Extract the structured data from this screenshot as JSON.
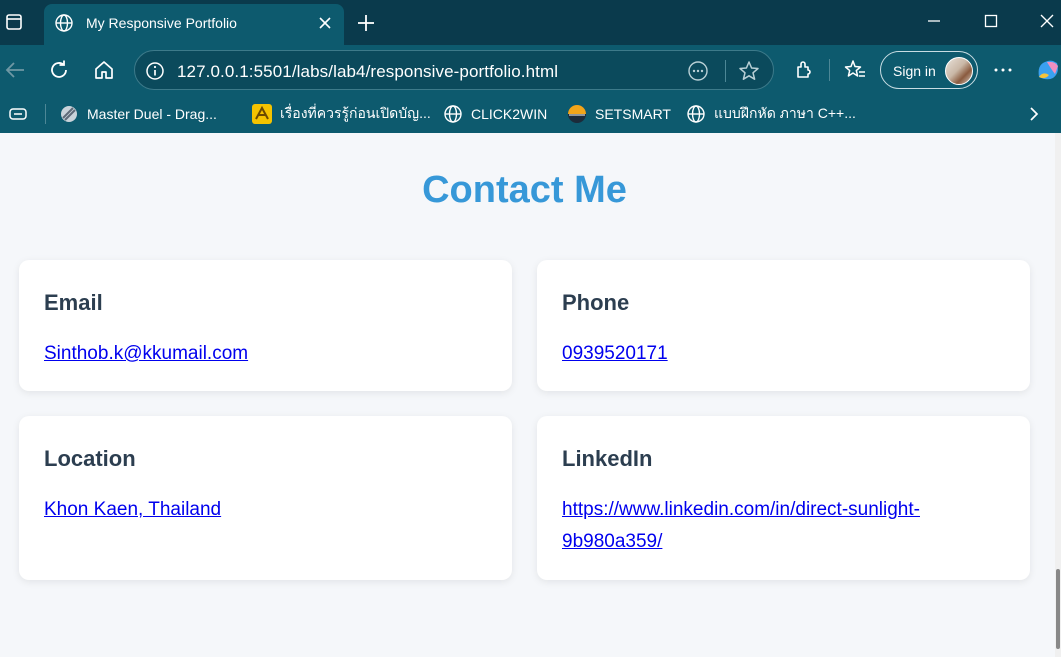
{
  "browser": {
    "tab_title": "My Responsive Portfolio",
    "url": "127.0.0.1:5501/labs/lab4/responsive-portfolio.html",
    "signin_label": "Sign in",
    "bookmarks": [
      {
        "label": "Master Duel - Drag...",
        "icon": "game-icon"
      },
      {
        "label": "เรื่องที่ควรรู้ก่อนเปิดบัญ...",
        "icon": "bank-logo-icon"
      },
      {
        "label": "CLICK2WIN",
        "icon": "globe-icon"
      },
      {
        "label": "SETSMART",
        "icon": "setsmart-logo-icon"
      },
      {
        "label": "แบบฝึกหัด ภาษา C++...",
        "icon": "globe-icon"
      }
    ]
  },
  "page": {
    "heading": "Contact Me",
    "cards": [
      {
        "title": "Email",
        "value": "Sinthob.k@kkumail.com"
      },
      {
        "title": "Phone",
        "value": "0939520171"
      },
      {
        "title": "Location",
        "value": "Khon Kaen, Thailand"
      },
      {
        "title": "LinkedIn",
        "value": "https://www.linkedin.com/in/direct-sunlight-9b980a359/"
      }
    ]
  },
  "colors": {
    "chrome_dark": "#0a3a4c",
    "chrome": "#0d5a6e",
    "heading": "#3798d8",
    "card_title": "#2c3e50",
    "link": "#0000ee"
  }
}
